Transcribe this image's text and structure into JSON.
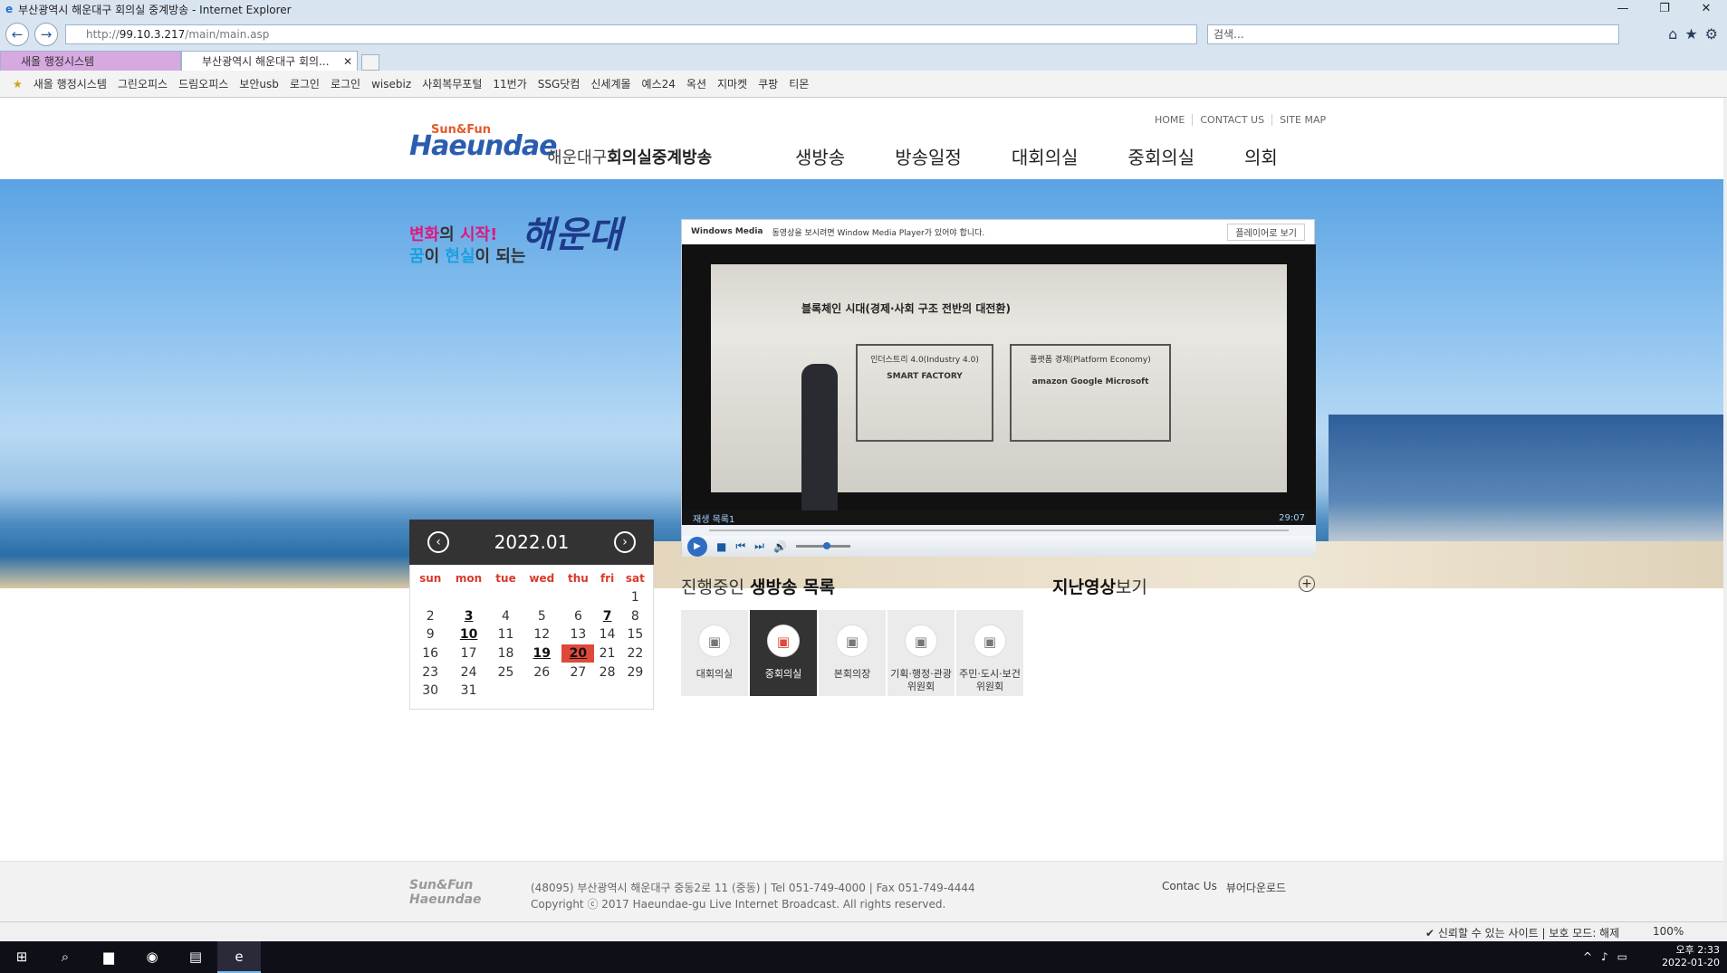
{
  "window": {
    "title": "부산광역시 해운대구 회의실 중계방송 - Internet Explorer",
    "min": "—",
    "max": "❐",
    "close": "✕"
  },
  "address": {
    "prefix": "http://",
    "host": "99.10.3.217",
    "path": "/main/main.asp",
    "search_placeholder": "검색..."
  },
  "tabs": [
    {
      "label": "새올 행정시스템"
    },
    {
      "label": "부산광역시 해운대구 회의...",
      "close": "✕"
    }
  ],
  "favorites": [
    "새올 행정시스템",
    "그린오피스",
    "드림오피스",
    "보안usb",
    "로그인",
    "로그인",
    "wisebiz",
    "사회복무포털",
    "11번가",
    "SSG닷컴",
    "신세계몰",
    "예스24",
    "옥션",
    "지마켓",
    "쿠팡",
    "티몬"
  ],
  "site": {
    "logo_top": "Sun&Fun",
    "logo_main": "Haeundae",
    "logo_sub_light": "해운대구",
    "logo_sub_bold": "회의실중계방송",
    "util": [
      "HOME",
      "CONTACT US",
      "SITE MAP"
    ],
    "gnb": [
      "생방송",
      "방송일정",
      "대회의실",
      "중회의실",
      "의회"
    ]
  },
  "hero": {
    "slogan_a1": "변화",
    "slogan_a2": "의 ",
    "slogan_a3": "시작!",
    "slogan_b1": "꿈",
    "slogan_b2": "이 ",
    "slogan_b3": "현실",
    "slogan_b4": "이 되는",
    "slogan_big": "해운대"
  },
  "player": {
    "brand": "Windows Media",
    "notice": "동영상을 보시려면 Window Media Player가 있어야 합니다.",
    "open_btn": "플레이어로 보기",
    "playlist": "재생 목록1",
    "time": "29:07",
    "slide_title": "블록체인 시대(경제·사회 구조 전반의 대전환)",
    "box1_title": "인더스트리 4.0(Industry 4.0)",
    "box1_sub": "SMART FACTORY",
    "box2_title": "플랫폼 경제(Platform Economy)",
    "box2_logos": "amazon   Google   Microsoft"
  },
  "calendar": {
    "month": "2022.01",
    "prev": "‹",
    "next": "›",
    "days": [
      "sun",
      "mon",
      "tue",
      "wed",
      "thu",
      "fri",
      "sat"
    ],
    "weeks": [
      [
        "",
        "",
        "",
        "",
        "",
        "",
        "1"
      ],
      [
        "2",
        "3",
        "4",
        "5",
        "6",
        "7",
        "8"
      ],
      [
        "9",
        "10",
        "11",
        "12",
        "13",
        "14",
        "15"
      ],
      [
        "16",
        "17",
        "18",
        "19",
        "20",
        "21",
        "22"
      ],
      [
        "23",
        "24",
        "25",
        "26",
        "27",
        "28",
        "29"
      ],
      [
        "30",
        "31",
        "",
        "",
        "",
        "",
        ""
      ]
    ],
    "event_days": [
      "3",
      "7",
      "10",
      "19"
    ],
    "today": "20"
  },
  "live": {
    "title_light": "진행중인 ",
    "title_bold": "생방송 목록",
    "rooms": [
      {
        "label": "대회의실",
        "active": false
      },
      {
        "label": "중회의실",
        "active": true
      },
      {
        "label": "본회의장",
        "active": false
      },
      {
        "label": "기획·행정·관광위원회",
        "active": false
      },
      {
        "label": "주민·도시·보건위원회",
        "active": false
      }
    ]
  },
  "past": {
    "title_bold": "지난영상",
    "title_light": "보기",
    "plus": "+"
  },
  "footer": {
    "logo": "Sun&Fun Haeundae",
    "address": "(48095) 부산광역시 해운대구 중동2로 11 (중동)  |  Tel 051-749-4000  |  Fax 051-749-4444",
    "copyright": "Copyright ⓒ 2017 Haeundae-gu Live Internet Broadcast. All rights reserved.",
    "link1": "Contac Us",
    "link2": "뷰어다운로드"
  },
  "status": {
    "trust": "✔ 신뢰할 수 있는 사이트 | 보호 모드: 해제",
    "zoom": "100%"
  },
  "taskbar": {
    "time": "오후 2:33",
    "date": "2022-01-20"
  }
}
